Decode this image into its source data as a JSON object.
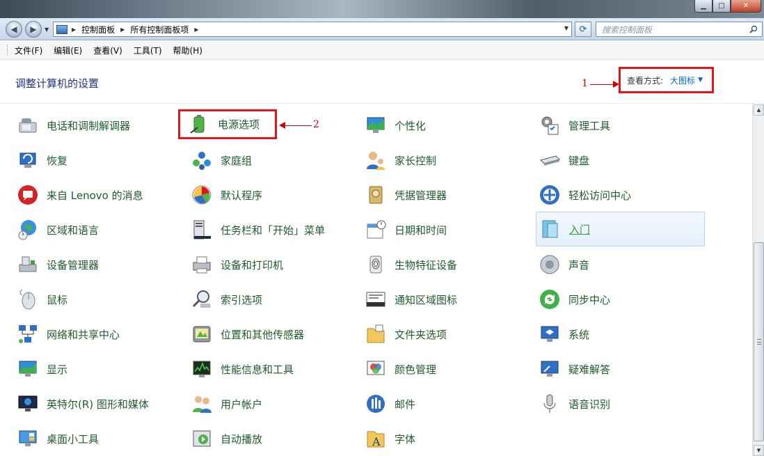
{
  "window": {
    "minimize_glyph": "▁",
    "maximize_glyph": "□",
    "close_glyph": "✕"
  },
  "nav": {
    "back_glyph": "◀",
    "forward_glyph": "▶",
    "breadcrumbs": [
      "控制面板",
      "所有控制面板项"
    ],
    "search_placeholder": "搜索控制面板"
  },
  "menu": [
    "文件(F)",
    "编辑(E)",
    "查看(V)",
    "工具(T)",
    "帮助(H)"
  ],
  "header": {
    "title": "调整计算机的设置",
    "view_by_label": "查看方式:",
    "view_by_value": "大图标"
  },
  "annotations": [
    "1",
    "2"
  ],
  "columns": [
    [
      {
        "label": "电话和调制解调器",
        "icon": "phone-modem-icon"
      },
      {
        "label": "恢复",
        "icon": "recovery-icon"
      },
      {
        "label": "来自 Lenovo 的消息",
        "icon": "lenovo-message-icon"
      },
      {
        "label": "区域和语言",
        "icon": "region-language-icon"
      },
      {
        "label": "设备管理器",
        "icon": "device-manager-icon"
      },
      {
        "label": "鼠标",
        "icon": "mouse-icon"
      },
      {
        "label": "网络和共享中心",
        "icon": "network-icon"
      },
      {
        "label": "显示",
        "icon": "display-icon"
      },
      {
        "label": "英特尔(R) 图形和媒体",
        "icon": "intel-graphics-icon"
      },
      {
        "label": "桌面小工具",
        "icon": "gadgets-icon"
      }
    ],
    [
      {
        "label": "电源选项",
        "icon": "power-options-icon"
      },
      {
        "label": "家庭组",
        "icon": "homegroup-icon"
      },
      {
        "label": "默认程序",
        "icon": "default-programs-icon"
      },
      {
        "label": "任务栏和「开始」菜单",
        "icon": "taskbar-icon"
      },
      {
        "label": "设备和打印机",
        "icon": "printer-icon"
      },
      {
        "label": "索引选项",
        "icon": "indexing-icon"
      },
      {
        "label": "位置和其他传感器",
        "icon": "sensor-icon"
      },
      {
        "label": "性能信息和工具",
        "icon": "performance-icon"
      },
      {
        "label": "用户帐户",
        "icon": "user-accounts-icon"
      },
      {
        "label": "自动播放",
        "icon": "autoplay-icon"
      }
    ],
    [
      {
        "label": "个性化",
        "icon": "personalization-icon"
      },
      {
        "label": "家长控制",
        "icon": "parental-controls-icon"
      },
      {
        "label": "凭据管理器",
        "icon": "credential-manager-icon"
      },
      {
        "label": "日期和时间",
        "icon": "date-time-icon"
      },
      {
        "label": "生物特征设备",
        "icon": "biometric-icon"
      },
      {
        "label": "通知区域图标",
        "icon": "notification-icon"
      },
      {
        "label": "文件夹选项",
        "icon": "folder-options-icon"
      },
      {
        "label": "颜色管理",
        "icon": "color-management-icon"
      },
      {
        "label": "邮件",
        "icon": "mail-icon"
      },
      {
        "label": "字体",
        "icon": "fonts-icon"
      }
    ],
    [
      {
        "label": "管理工具",
        "icon": "admin-tools-icon"
      },
      {
        "label": "键盘",
        "icon": "keyboard-icon"
      },
      {
        "label": "轻松访问中心",
        "icon": "ease-of-access-icon"
      },
      {
        "label": "入门",
        "icon": "getting-started-icon"
      },
      {
        "label": "声音",
        "icon": "sound-icon"
      },
      {
        "label": "同步中心",
        "icon": "sync-center-icon"
      },
      {
        "label": "系统",
        "icon": "system-icon"
      },
      {
        "label": "疑难解答",
        "icon": "troubleshooting-icon"
      },
      {
        "label": "语音识别",
        "icon": "speech-recognition-icon"
      }
    ]
  ],
  "highlight_color": "#e1161b",
  "item_text_color": "#1e5b2e"
}
